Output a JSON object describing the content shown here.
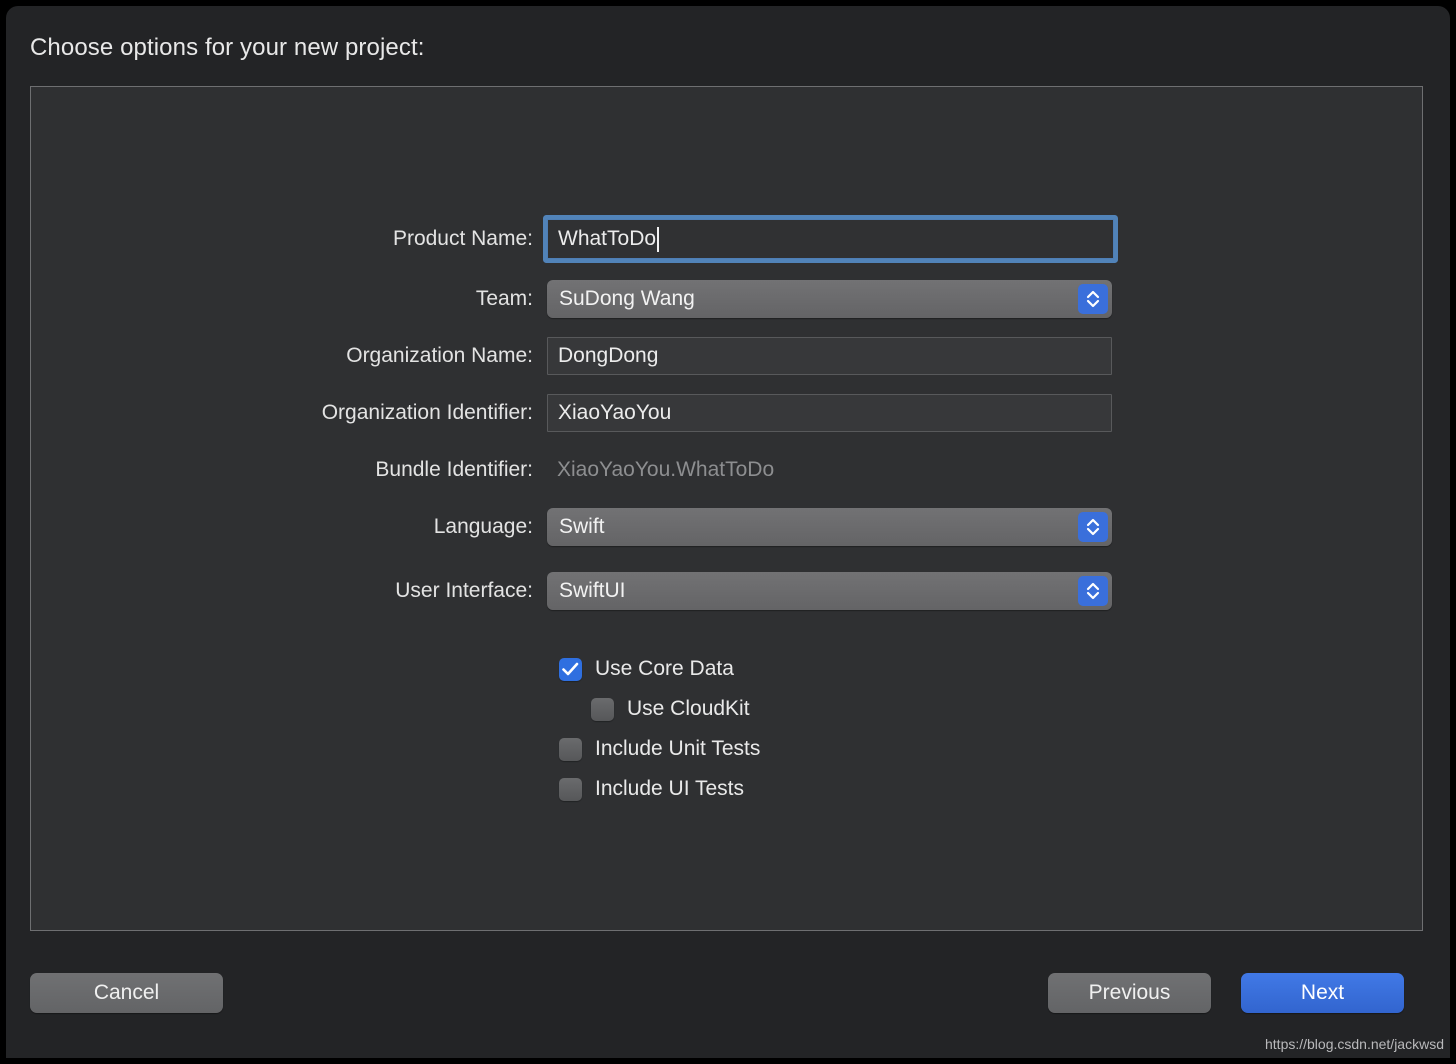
{
  "window": {
    "title": "Choose options for your new project:"
  },
  "form": {
    "fields": [
      {
        "label": "Product Name:",
        "value": "WhatToDo",
        "type": "textfield-focused"
      },
      {
        "label": "Team:",
        "value": "SuDong Wang",
        "type": "popup"
      },
      {
        "label": "Organization Name:",
        "value": "DongDong",
        "type": "textfield"
      },
      {
        "label": "Organization Identifier:",
        "value": "XiaoYaoYou",
        "type": "textfield"
      },
      {
        "label": "Bundle Identifier:",
        "value": "XiaoYaoYou.WhatToDo",
        "type": "static"
      },
      {
        "label": "Language:",
        "value": "Swift",
        "type": "popup"
      },
      {
        "label": "User Interface:",
        "value": "SwiftUI",
        "type": "popup"
      }
    ]
  },
  "checkboxes": [
    {
      "label": "Use Core Data",
      "checked": true,
      "indent": false
    },
    {
      "label": "Use CloudKit",
      "checked": false,
      "indent": true
    },
    {
      "label": "Include Unit Tests",
      "checked": false,
      "indent": false
    },
    {
      "label": "Include UI Tests",
      "checked": false,
      "indent": false
    }
  ],
  "footer": {
    "cancel_label": "Cancel",
    "previous_label": "Previous",
    "next_label": "Next"
  },
  "watermark": {
    "text": "https://blog.csdn.net/jackwsd"
  },
  "colors": {
    "window_background": "#232426",
    "panel_background": "#2f3032",
    "panel_border": "#6e6f71",
    "accent_blue": "#3a6fdb",
    "focus_ring": "#5388c1",
    "control_gray": "#6a6b6d",
    "text_primary": "#e8e8e8",
    "text_disabled": "#8d8e90"
  }
}
